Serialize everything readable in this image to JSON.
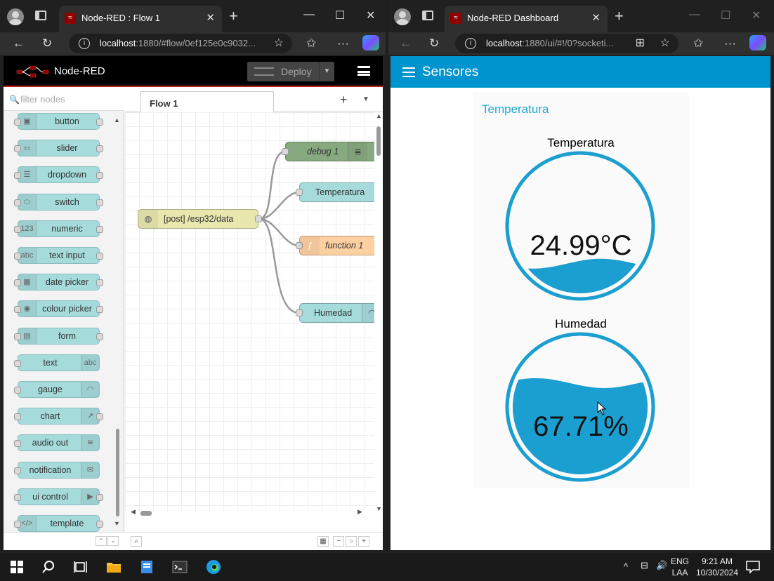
{
  "left_browser": {
    "tab_title": "Node-RED : Flow 1",
    "url_host": "localhost",
    "url_rest": ":1880/#flow/0ef125e0c9032..."
  },
  "right_browser": {
    "tab_title": "Node-RED Dashboard",
    "url_host": "localhost",
    "url_rest": ":1880/ui/#!/0?socketi..."
  },
  "nodered": {
    "title": "Node-RED",
    "deploy_label": "Deploy",
    "filter_placeholder": "filter nodes",
    "flow_tab": "Flow 1",
    "palette": [
      {
        "label": "button",
        "icon": "button-icon"
      },
      {
        "label": "slider",
        "icon": "slider-icon"
      },
      {
        "label": "dropdown",
        "icon": "dropdown-icon"
      },
      {
        "label": "switch",
        "icon": "switch-icon"
      },
      {
        "label": "numeric",
        "icon": "numeric-icon",
        "glyph": "123"
      },
      {
        "label": "text input",
        "icon": "text-input-icon",
        "glyph": "abc"
      },
      {
        "label": "date picker",
        "icon": "calendar-icon"
      },
      {
        "label": "colour picker",
        "icon": "palette-icon"
      },
      {
        "label": "form",
        "icon": "form-icon"
      },
      {
        "label": "text",
        "icon": "text-icon",
        "glyph": "abc"
      },
      {
        "label": "gauge",
        "icon": "gauge-icon"
      },
      {
        "label": "chart",
        "icon": "chart-icon"
      },
      {
        "label": "audio out",
        "icon": "audio-icon"
      },
      {
        "label": "notification",
        "icon": "envelope-icon"
      },
      {
        "label": "ui control",
        "icon": "ui-control-icon"
      },
      {
        "label": "template",
        "icon": "code-icon",
        "glyph": "</>"
      }
    ],
    "flow_nodes": {
      "http_in": "[post] /esp32/data",
      "debug": "debug 1",
      "temperatura": "Temperatura",
      "function": "function 1",
      "humedad": "Humedad"
    }
  },
  "dashboard": {
    "title": "Sensores",
    "group_title": "Temperatura",
    "gauges": [
      {
        "label": "Temperatura",
        "value": "24.99°C",
        "level": 0.22
      },
      {
        "label": "Humedad",
        "value": "67.71%",
        "level": 0.6771
      }
    ],
    "accent": "#0094ce",
    "fill_color": "#1a9fd0"
  },
  "taskbar": {
    "lang1": "ENG",
    "lang2": "LAA",
    "time": "9:21 AM",
    "date": "10/30/2024"
  }
}
